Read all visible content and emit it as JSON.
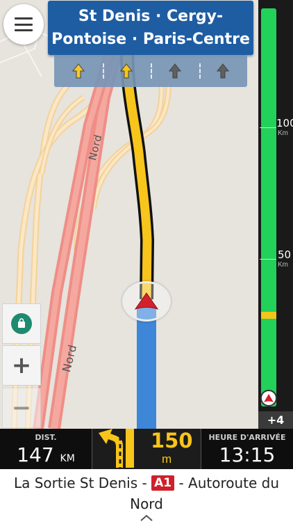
{
  "sign": {
    "line1": "St Denis · Cergy-",
    "line2": "Pontoise · Paris-Centre",
    "background": "#1f5da3"
  },
  "lanes": [
    {
      "icon": "arrow-up-icon",
      "active": true
    },
    {
      "icon": "arrow-up-icon",
      "active": true
    },
    {
      "icon": "arrow-up-icon",
      "active": false
    },
    {
      "icon": "arrow-up-icon",
      "active": false
    }
  ],
  "map": {
    "road_labels": [
      "Nord",
      "Nord"
    ]
  },
  "distance_bar": {
    "marks": [
      {
        "value": "100",
        "unit": "Km"
      },
      {
        "value": "50",
        "unit": "Km"
      }
    ],
    "extra": "+4"
  },
  "info": {
    "dist_label": "DIST.",
    "dist_value": "147",
    "dist_unit": "KM",
    "next_turn_distance": "150",
    "next_turn_unit": "m",
    "eta_label": "HEURE D'ARRIVÉE",
    "eta_value": "13:15"
  },
  "street": {
    "prefix": "La Sortie St Denis -",
    "road_number": "A1",
    "suffix": "- Autoroute du Nord"
  },
  "colors": {
    "route": "#f7c51b",
    "traveled": "#3d86d8",
    "progress": "#22d15a",
    "marker": "#d3212c"
  }
}
